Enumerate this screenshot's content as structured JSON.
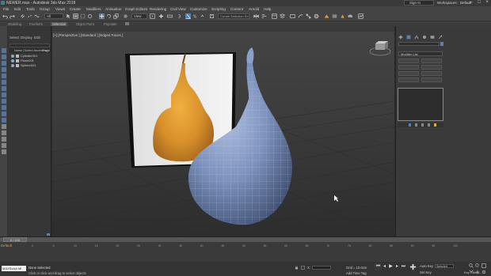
{
  "titlebar": {
    "title": "NEWER.max - Autodesk 3ds Max 2018",
    "sign_in": "Sign In",
    "workspaces_label": "Workspaces:",
    "workspaces_value": "Default"
  },
  "menu": [
    "File",
    "Edit",
    "Tools",
    "Group",
    "Views",
    "Create",
    "Modifiers",
    "Animation",
    "Graph Editors",
    "Rendering",
    "Civil View",
    "Customize",
    "Scripting",
    "Content",
    "Arnold",
    "Help"
  ],
  "toolbar": {
    "filter_all": "All",
    "view": "View",
    "selection_set": "Create Selection Se"
  },
  "ribbon": {
    "tabs": [
      "Modeling",
      "Freeform",
      "Selection",
      "Object Paint",
      "Populate"
    ],
    "active": "Selection"
  },
  "explorer": {
    "tabs": [
      "Select",
      "Display",
      "Edit"
    ],
    "header": "Name (Sorted Ascending)",
    "header_right": "Froze",
    "items": [
      "Cylinder001",
      "Plane001",
      "Sphere001"
    ]
  },
  "viewport": {
    "label": "[+] [Perspective ] [Standard ] [Edged Faces ]"
  },
  "command_panel": {
    "modifier_list": "Modifier List",
    "buttons": [
      "",
      "",
      "",
      "",
      "",
      "",
      "",
      "",
      "",
      "",
      "",
      ""
    ]
  },
  "timeslider": {
    "label": "0 / 100",
    "ticks": [
      "0",
      "5",
      "10",
      "15",
      "20",
      "25",
      "30",
      "35",
      "40",
      "45",
      "50",
      "55",
      "60",
      "65",
      "70",
      "75",
      "80",
      "85",
      "90",
      "95",
      "100"
    ]
  },
  "statusbar": {
    "layer": "Default",
    "script_box": "MAXScript Mi",
    "status_line1": "None Selected",
    "status_line2": "Click or click-and-drag to select objects",
    "x_label": "X:",
    "y_label": "Y:",
    "z_label": "Z:",
    "grid": "Grid = 10.0cm",
    "add_time_tag": "Add Time Tag",
    "auto_key": "Auto Key",
    "auto_key_value": "Selected",
    "set_key": "Set Key",
    "key_filters": "Key Filters..."
  },
  "colors": {
    "accent": "#e8a030",
    "active_blue": "#5a7fb3",
    "pear_model": "#7d93bd"
  }
}
